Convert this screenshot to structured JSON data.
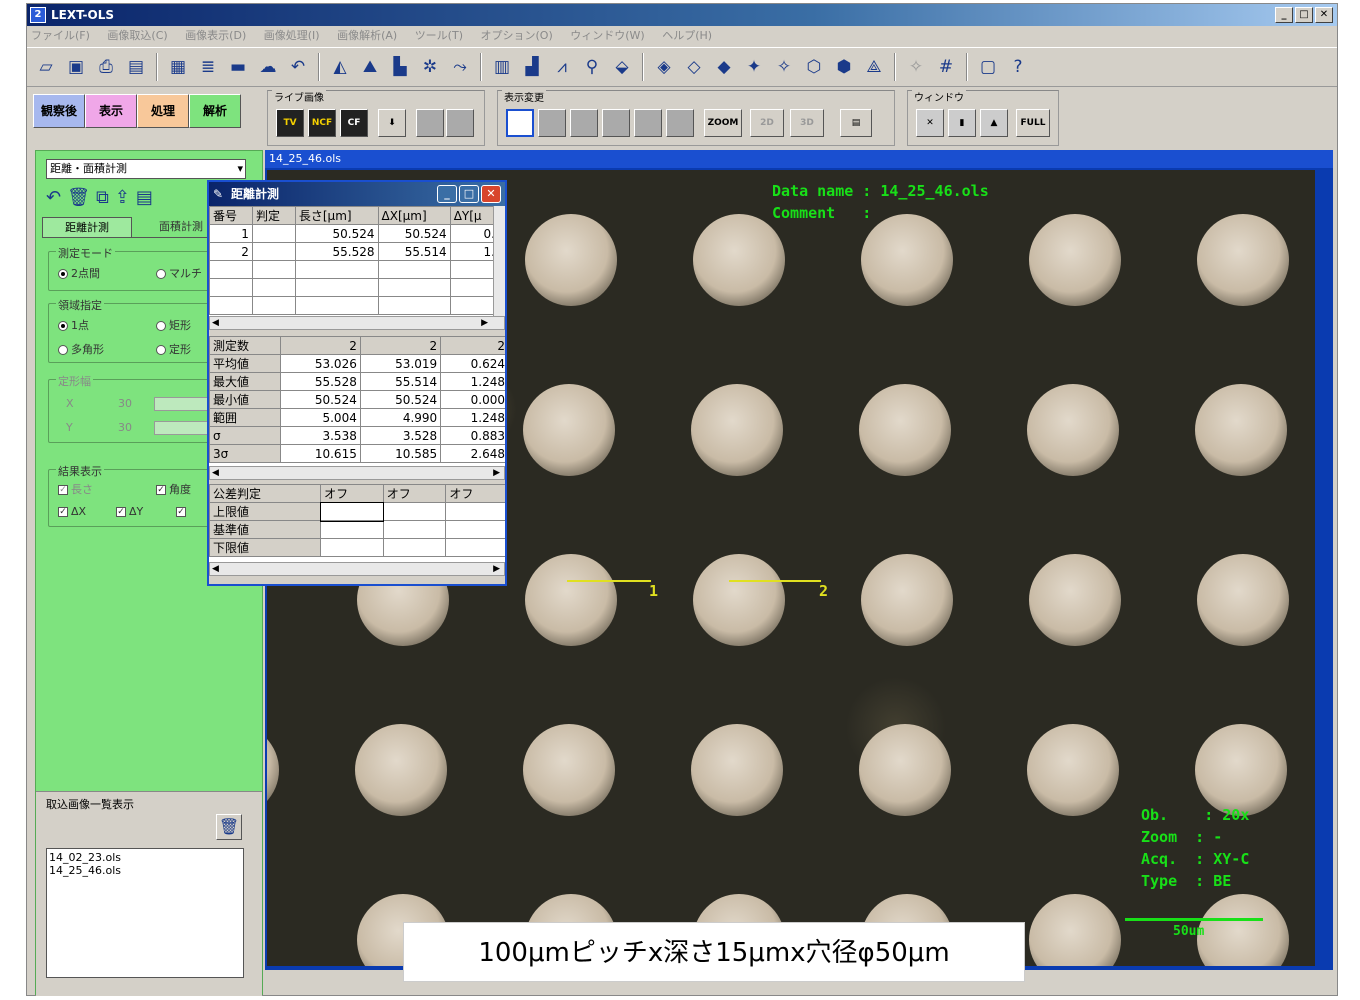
{
  "window": {
    "title": "LEXT-OLS",
    "app_icon": "2",
    "minimize": "_",
    "maximize": "□",
    "close": "✕"
  },
  "menu": [
    "ファイル(F)",
    "画像取込(C)",
    "画像表示(D)",
    "画像処理(I)",
    "画像解析(A)",
    "ツール(T)",
    "オプション(O)",
    "ウィンドウ(W)",
    "ヘルプ(H)"
  ],
  "modes": [
    "観察後",
    "表示",
    "処理",
    "解析"
  ],
  "groups": {
    "live": {
      "title": "ライブ画像",
      "tv": "TV",
      "ncf": "NCF",
      "cf": "CF"
    },
    "display": {
      "title": "表示変更",
      "zoom": "ZOOM",
      "zoom_2d": "2D",
      "zoom_3d": "3D"
    },
    "window": {
      "title": "ウィンドウ",
      "full": "FULL"
    }
  },
  "left": {
    "select": "距離・面積計測",
    "tab_distance": "距離計測",
    "tab_area": "面積計測",
    "mode_group": "測定モード",
    "mode_2pt": "2点間",
    "mode_multi": "マルチ",
    "region_group": "領域指定",
    "region_1pt": "1点",
    "region_rect": "矩形",
    "region_poly": "多角形",
    "region_fixed": "定形",
    "fixed_group": "定形幅",
    "x_label": "X",
    "x_value": "30",
    "y_label": "Y",
    "y_value": "30",
    "result_group": "結果表示",
    "chk_length": "長さ",
    "chk_angle": "角度",
    "chk_dx": "ΔX",
    "chk_dy": "ΔY",
    "thumb_title": "取込画像一覧表示",
    "files": [
      "14_02_23.ols",
      "14_25_46.ols"
    ]
  },
  "image": {
    "tab_title": "14_25_46.ols",
    "data_name": "Data name : 14_25_46.ols",
    "comment": "Comment   :",
    "ob": "Ob.    : 20x",
    "zoom": "Zoom  : -",
    "acq": "Acq.  : XY-C",
    "type": "Type  : BE",
    "scale": "50um",
    "marker1": "1",
    "marker2": "2",
    "caption": "100μmピッチx深さ15μmx穴径φ50μm"
  },
  "dialog": {
    "title": "距離計測",
    "headers": [
      "番号",
      "判定",
      "長さ[μm]",
      "ΔX[μm]",
      "ΔY[μ"
    ],
    "rows": [
      [
        "1",
        "",
        "50.524",
        "50.524",
        "0."
      ],
      [
        "2",
        "",
        "55.528",
        "55.514",
        "1."
      ]
    ],
    "stats_headers": [
      "測定数",
      "2",
      "2",
      "2"
    ],
    "stats": [
      [
        "平均値",
        "53.026",
        "53.019",
        "0.624"
      ],
      [
        "最大値",
        "55.528",
        "55.514",
        "1.248"
      ],
      [
        "最小値",
        "50.524",
        "50.524",
        "0.000"
      ],
      [
        "範囲",
        "5.004",
        "4.990",
        "1.248"
      ],
      [
        "σ",
        "3.538",
        "3.528",
        "0.883"
      ],
      [
        "3σ",
        "10.615",
        "10.585",
        "2.648"
      ]
    ],
    "tol_headers": [
      "公差判定",
      "オフ",
      "オフ",
      "オフ"
    ],
    "tol_rows": [
      "上限値",
      "基準値",
      "下限値"
    ]
  }
}
